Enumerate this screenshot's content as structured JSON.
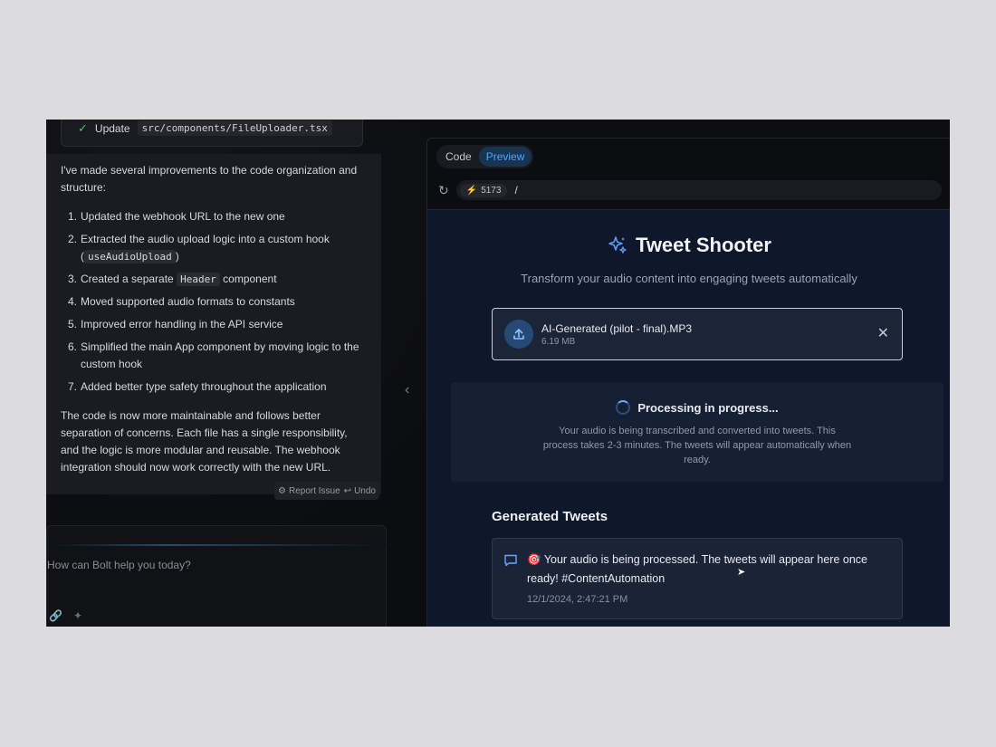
{
  "chat": {
    "step_label": "Update",
    "step_file": "src/components/FileUploader.tsx",
    "intro": "I've made several improvements to the code organization and structure:",
    "items": [
      {
        "num": "1.",
        "text": "Updated the webhook URL to the new one"
      },
      {
        "num": "2.",
        "pre": "Extracted the audio upload logic into a custom hook (",
        "code": "useAudioUpload",
        "post": ")"
      },
      {
        "num": "3.",
        "pre": "Created a separate ",
        "code": "Header",
        "post": " component"
      },
      {
        "num": "4.",
        "text": "Moved supported audio formats to constants"
      },
      {
        "num": "5.",
        "text": "Improved error handling in the API service"
      },
      {
        "num": "6.",
        "text": "Simplified the main App component by moving logic to the custom hook"
      },
      {
        "num": "7.",
        "text": "Added better type safety throughout the application"
      }
    ],
    "outro": "The code is now more maintainable and follows better separation of concerns. Each file has a single responsibility, and the logic is more modular and reusable. The webhook integration should now work correctly with the new URL.",
    "report_label": "Report Issue",
    "undo_label": "Undo",
    "input_placeholder": "How can Bolt help you today?"
  },
  "preview": {
    "tabs": [
      {
        "label": "Code"
      },
      {
        "label": "Preview"
      }
    ],
    "active_tab": "Preview",
    "port": "5173",
    "path": "/"
  },
  "app": {
    "title": "Tweet Shooter",
    "subtitle": "Transform your audio content into engaging tweets automatically",
    "file_name": "AI-Generated (pilot - final).MP3",
    "file_size": "6.19 MB",
    "processing_title": "Processing in progress...",
    "processing_desc": "Your audio is being transcribed and converted into tweets. This process takes 2-3 minutes. The tweets will appear automatically when ready.",
    "generated_title": "Generated Tweets",
    "tweet": {
      "emoji": "🎯",
      "text": "Your audio is being processed. The tweets will appear here once ready! #ContentAutomation",
      "time": "12/1/2024, 2:47:21 PM"
    }
  },
  "colors": {
    "accent": "#4da6ff",
    "success": "#3ec46d",
    "app_bg": "#0f172a"
  }
}
